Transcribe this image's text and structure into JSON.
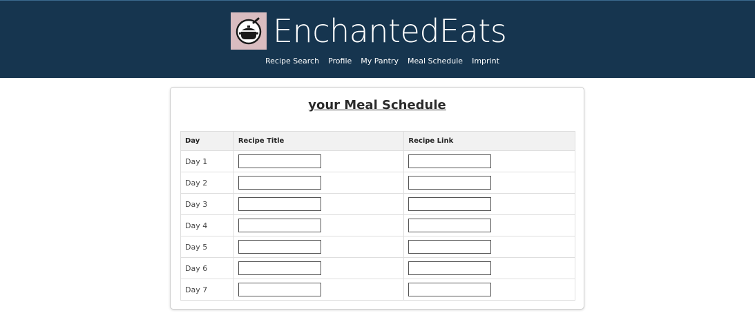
{
  "brand": {
    "name": "EnchantedEats",
    "logo_icon": "cooking-pot-icon",
    "logo_bg": "#d9bcc0",
    "header_bg": "#16354f"
  },
  "nav": {
    "items": [
      "Recipe Search",
      "Profile",
      "My Pantry",
      "Meal Schedule",
      "Imprint"
    ]
  },
  "schedule": {
    "title": "your Meal Schedule",
    "columns": {
      "day": "Day",
      "recipe_title": "Recipe Title",
      "recipe_link": "Recipe Link"
    },
    "rows": [
      {
        "day": "Day 1",
        "recipe_title": "",
        "recipe_link": ""
      },
      {
        "day": "Day 2",
        "recipe_title": "",
        "recipe_link": ""
      },
      {
        "day": "Day 3",
        "recipe_title": "",
        "recipe_link": ""
      },
      {
        "day": "Day 4",
        "recipe_title": "",
        "recipe_link": ""
      },
      {
        "day": "Day 5",
        "recipe_title": "",
        "recipe_link": ""
      },
      {
        "day": "Day 6",
        "recipe_title": "",
        "recipe_link": ""
      },
      {
        "day": "Day 7",
        "recipe_title": "",
        "recipe_link": ""
      }
    ]
  }
}
